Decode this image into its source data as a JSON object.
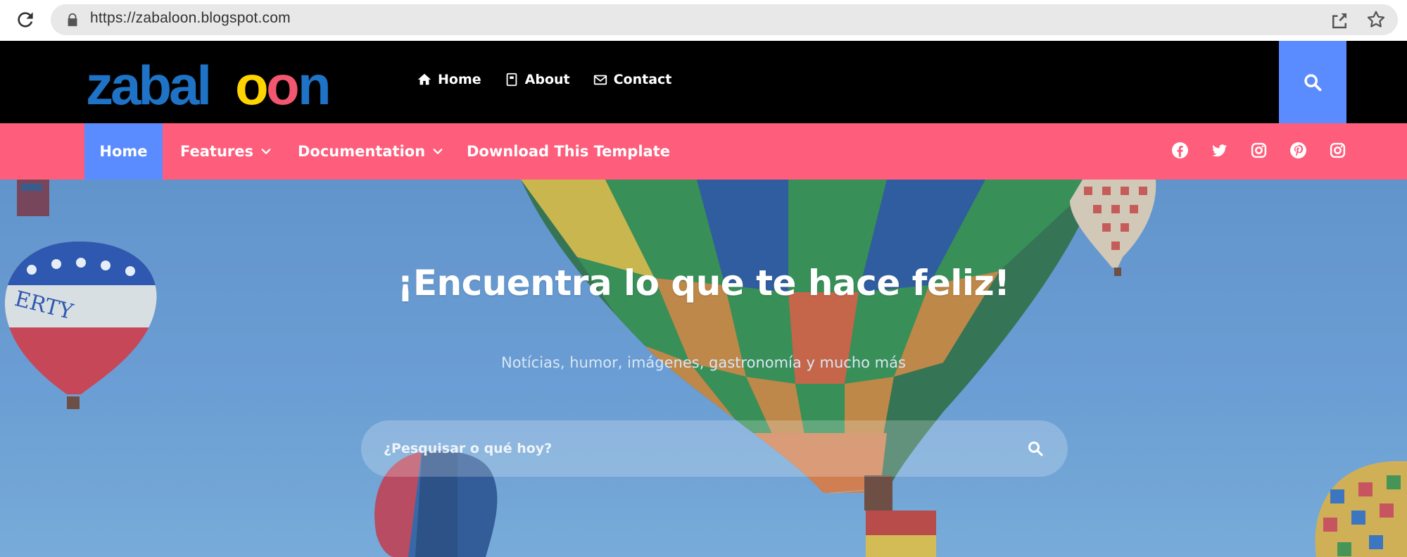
{
  "browser": {
    "url": "https://zabaloon.blogspot.com",
    "icons": [
      "reload-icon",
      "lock-icon",
      "share-icon",
      "star-icon"
    ]
  },
  "header": {
    "logo_text": "zabaloon",
    "logo_colors": [
      "#1f73c6",
      "#ffd400",
      "#f3576f"
    ],
    "top_nav": [
      {
        "label": "Home",
        "icon": "home-icon"
      },
      {
        "label": "About",
        "icon": "book-icon"
      },
      {
        "label": "Contact",
        "icon": "envelope-icon"
      }
    ],
    "search_icon": "search-icon"
  },
  "main_nav": {
    "items": [
      {
        "label": "Home",
        "active": true
      },
      {
        "label": "Features",
        "dropdown": true
      },
      {
        "label": "Documentation",
        "dropdown": true
      },
      {
        "label": "Download This Template",
        "dropdown": false
      }
    ],
    "socials": [
      "facebook-icon",
      "twitter-icon",
      "instagram-icon",
      "pinterest-icon",
      "instagram-icon"
    ]
  },
  "hero": {
    "title": "¡Encuentra lo que te hace feliz!",
    "subtitle": "Notícias, humor, imágenes, gastronomía y mucho más",
    "search_placeholder": "¿Pesquisar o qué hoy?"
  },
  "colors": {
    "header_bg": "#000000",
    "nav_bg": "#fe5d7b",
    "accent_blue": "#5b8cff",
    "url_bar_bg": "#e8e8e8"
  }
}
